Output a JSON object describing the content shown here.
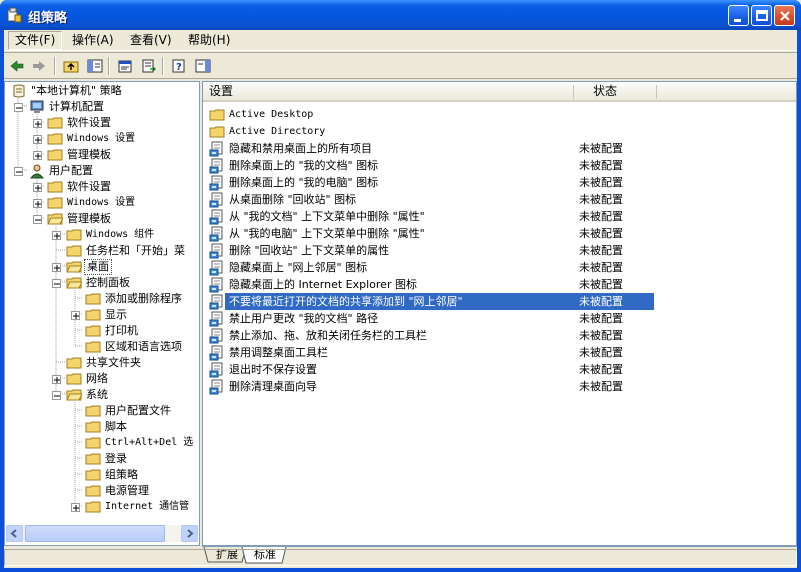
{
  "window": {
    "title": "组策略"
  },
  "menu": [
    {
      "label": "文件(F)"
    },
    {
      "label": "操作(A)"
    },
    {
      "label": "查看(V)"
    },
    {
      "label": "帮助(H)"
    }
  ],
  "tree": {
    "root": "\"本地计算机\" 策略",
    "computer": "计算机配置",
    "computer_children": [
      "软件设置",
      "Windows 设置",
      "管理模板"
    ],
    "user": "用户配置",
    "user_children": [
      "软件设置",
      "Windows 设置",
      "管理模板"
    ],
    "admin_templates": [
      "Windows 组件",
      "任务栏和「开始」菜",
      "桌面",
      "控制面板",
      "共享文件夹",
      "网络",
      "系统"
    ],
    "control_panel": [
      "添加或删除程序",
      "显示",
      "打印机",
      "区域和语言选项"
    ],
    "system": [
      "用户配置文件",
      "脚本",
      "Ctrl+Alt+Del 选",
      "登录",
      "组策略",
      "电源管理",
      "Internet 通信管"
    ]
  },
  "list": {
    "headers": {
      "setting": "设置",
      "state": "状态"
    },
    "folders": [
      "Active Desktop",
      "Active Directory"
    ],
    "rows": [
      {
        "name": "隐藏和禁用桌面上的所有项目",
        "state": "未被配置"
      },
      {
        "name": "删除桌面上的 \"我的文档\" 图标",
        "state": "未被配置"
      },
      {
        "name": "删除桌面上的 \"我的电脑\" 图标",
        "state": "未被配置"
      },
      {
        "name": "从桌面删除 \"回收站\" 图标",
        "state": "未被配置"
      },
      {
        "name": "从 \"我的文档\" 上下文菜单中删除 \"属性\"",
        "state": "未被配置"
      },
      {
        "name": "从 \"我的电脑\" 上下文菜单中删除 \"属性\"",
        "state": "未被配置"
      },
      {
        "name": "删除 \"回收站\" 上下文菜单的属性",
        "state": "未被配置"
      },
      {
        "name": "隐藏桌面上 \"网上邻居\" 图标",
        "state": "未被配置"
      },
      {
        "name": "隐藏桌面上的 Internet Explorer 图标",
        "state": "未被配置"
      },
      {
        "name": "不要将最近打开的文档的共享添加到 \"网上邻居\"",
        "state": "未被配置"
      },
      {
        "name": "禁止用户更改 \"我的文档\" 路径",
        "state": "未被配置"
      },
      {
        "name": "禁止添加、拖、放和关闭任务栏的工具栏",
        "state": "未被配置"
      },
      {
        "name": "禁用调整桌面工具栏",
        "state": "未被配置"
      },
      {
        "name": "退出时不保存设置",
        "state": "未被配置"
      },
      {
        "name": "删除清理桌面向导",
        "state": "未被配置"
      }
    ],
    "selected_index": 9
  },
  "tabs": [
    "扩展",
    "标准"
  ],
  "icons": [
    "gpedit-icon",
    "back-icon",
    "forward-icon",
    "up-folder-icon",
    "show-tree-icon",
    "properties-icon",
    "export-icon",
    "help-icon",
    "show-hide-icon",
    "folder-icon",
    "policy-setting-icon",
    "computer-icon",
    "user-icon"
  ]
}
